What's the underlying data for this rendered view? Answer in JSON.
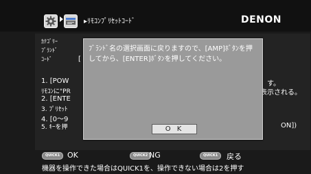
{
  "header": {
    "title": "▸ﾘﾓｺﾝﾌﾟﾘｾｯﾄｺｰﾄﾞ",
    "brand": "DENON",
    "icons": [
      "gear-icon",
      "setup-menu-icon"
    ]
  },
  "body": {
    "labels": {
      "category": "ｶﾃｺﾞﾘｰ",
      "brand": "ﾌﾞﾗﾝﾄﾞ",
      "code": "ｺｰﾄﾞ",
      "code_bracket": "["
    },
    "steps": {
      "step1": "1. [POW",
      "step1_tail": "す。",
      "note": "ﾘﾓｺﾝに\"PR",
      "note_tail": "表示される。",
      "step2": "2. [ENTE",
      "step3": "3. ﾌﾟﾘｾｯﾄ",
      "step4": "4. [0〜9",
      "step5": "5. ｷｰを押",
      "step5_tail": "ON])"
    }
  },
  "dialog": {
    "message": "ﾌﾞﾗﾝﾄﾞ名の選択画面に戻りますので、[AMP]ﾎﾞﾀﾝを押してから、[ENTER]ﾎﾞﾀﾝを押してください。",
    "ok_label": "O K"
  },
  "footer": {
    "quick1_badge": "QUICK1",
    "quick1_label": "OK",
    "quick2_badge": "QUICK2",
    "quick2_label": "NG",
    "quick3_badge": "QUICK1",
    "quick3_label": "戻る",
    "help": "機器を操作できた場合はQUICK1を、操作できない場合は2を押す"
  }
}
